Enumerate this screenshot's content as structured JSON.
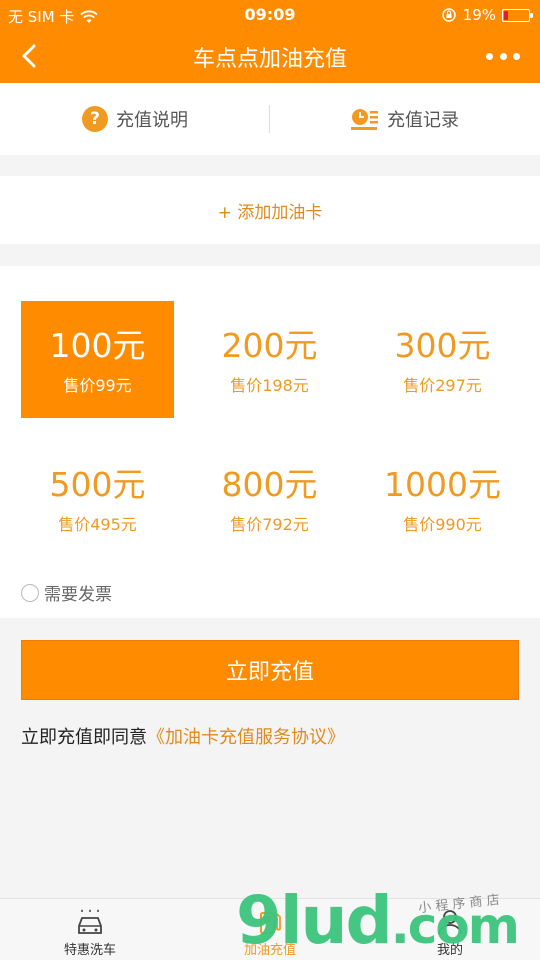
{
  "status_bar": {
    "carrier": "无 SIM 卡",
    "time": "09:09",
    "battery": "19%",
    "battery_level": 0.19,
    "battery_color": "#e02020"
  },
  "nav": {
    "title": "车点点加油充值",
    "back_icon": "chevron-left-icon",
    "more_icon": "more-dots-icon"
  },
  "info": {
    "explain_label": "充值说明",
    "explain_icon": "question-icon",
    "record_label": "充值记录",
    "record_icon": "record-list-icon"
  },
  "add_card": {
    "label": "+ 添加加油卡"
  },
  "amounts": [
    {
      "face": "100元",
      "price": "售价99元",
      "selected": true
    },
    {
      "face": "200元",
      "price": "售价198元",
      "selected": false
    },
    {
      "face": "300元",
      "price": "售价297元",
      "selected": false
    },
    {
      "face": "500元",
      "price": "售价495元",
      "selected": false
    },
    {
      "face": "800元",
      "price": "售价792元",
      "selected": false
    },
    {
      "face": "1000元",
      "price": "售价990元",
      "selected": false
    }
  ],
  "invoice": {
    "label": "需要发票",
    "checked": false
  },
  "recharge_button": {
    "label": "立即充值"
  },
  "agreement": {
    "prefix": "立即充值即同意",
    "link": "《加油卡充值服务协议》"
  },
  "tabs": [
    {
      "label": "特惠洗车",
      "icon": "car-wash-icon",
      "active": false
    },
    {
      "label": "加油充值",
      "icon": "fuel-icon",
      "active": true
    },
    {
      "label": "我的",
      "icon": "user-icon",
      "active": false
    }
  ],
  "watermark": {
    "text": "9lud",
    "suffix": ".com",
    "sub": "小 程 序 商 店"
  },
  "colors": {
    "accent": "#ff8c00",
    "accent_text": "#f19a22",
    "background": "#f4f4f4"
  }
}
